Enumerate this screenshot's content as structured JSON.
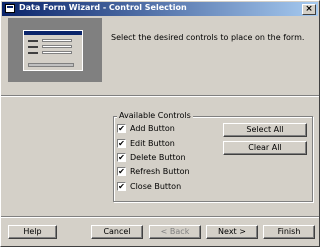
{
  "window": {
    "title": "Data Form Wizard - Control Selection",
    "close_glyph": "×"
  },
  "header": {
    "instruction": "Select the desired controls to place on the form."
  },
  "controls_group": {
    "label": "Available Controls",
    "items": [
      {
        "label": "Add Button",
        "mnemonic": "A",
        "checked": true
      },
      {
        "label": "Edit Button",
        "mnemonic": "E",
        "checked": true
      },
      {
        "label": "Delete Button",
        "mnemonic": "D",
        "checked": true
      },
      {
        "label": "Refresh Button",
        "mnemonic": "R",
        "checked": true
      },
      {
        "label": "Close Button",
        "mnemonic": "C",
        "checked": true
      }
    ],
    "select_all_label": "Select All",
    "clear_all_label": "Clear All"
  },
  "footer": {
    "help_label": "Help",
    "cancel_label": "Cancel",
    "back_label": "< Back",
    "next_label": "Next >",
    "finish_label": "Finish"
  },
  "check_glyph": "✔"
}
